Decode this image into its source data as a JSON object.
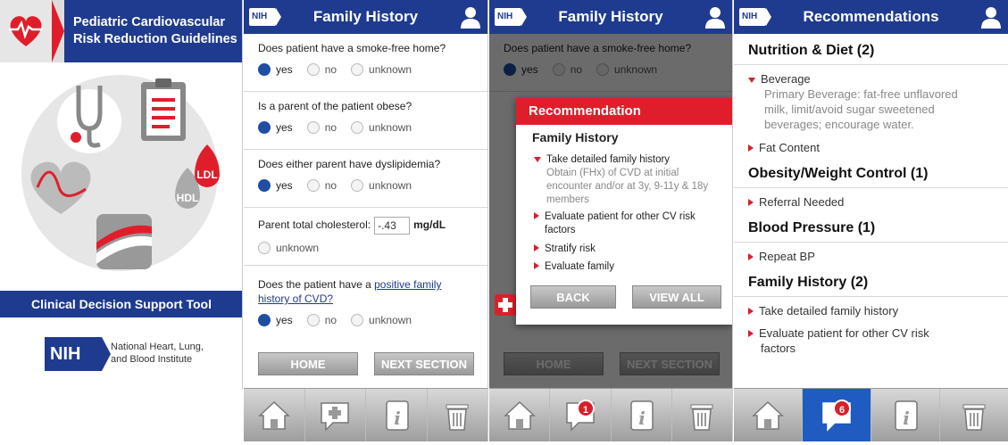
{
  "splash": {
    "title_line1": "Pediatric Cardiovascular",
    "title_line2": "Risk Reduction Guidelines",
    "hdl": "HDL",
    "ldl": "LDL",
    "tool_label": "Clinical Decision Support Tool",
    "nih_logo": "NIH",
    "institute_line1": "National Heart, Lung,",
    "institute_line2": "and Blood Institute"
  },
  "header": {
    "nih_badge": "NIH",
    "family_history_title": "Family History",
    "recommendations_title": "Recommendations"
  },
  "form": {
    "q1": "Does patient have a smoke-free home?",
    "q2": "Is a parent of the patient obese?",
    "q3": "Does either parent have dyslipidemia?",
    "q4_label": "Parent total cholesterol:",
    "q4_value": "-.43",
    "q4_unit": "mg/dL",
    "q5_prefix": "Does the patient have a",
    "q5_link_line1": "positive family",
    "q5_link_line2": "history of CVD?",
    "opt_yes": "yes",
    "opt_no": "no",
    "opt_unknown": "unknown",
    "home_button": "HOME",
    "next_button": "NEXT SECTION"
  },
  "modal": {
    "title": "Recommendation",
    "subtitle": "Family History",
    "item1": "Take detailed family history",
    "item1_detail_l1": "Obtain (FHx) of CVD at initial",
    "item1_detail_l2": "encounter and/or at 3y, 9-11y & 18y",
    "item1_detail_l3": "members",
    "item2_l1": "Evaluate patient for other CV risk",
    "item2_l2": "factors",
    "item3": "Stratify risk",
    "item4": "Evaluate family",
    "back_button": "BACK",
    "view_all_button": "VIEW ALL"
  },
  "tabbar": {
    "badge_panel3": "1",
    "badge_panel4": "6"
  },
  "recs": {
    "nutrition": "Nutrition & Diet (2)",
    "beverage": "Beverage",
    "beverage_d1": "Primary Beverage: fat-free unflavored",
    "beverage_d2": "milk, limit/avoid sugar sweetened",
    "beverage_d3": "beverages; encourage water.",
    "fat": "Fat Content",
    "obesity": "Obesity/Weight Control (1)",
    "referral": "Referral Needed",
    "bp": "Blood Pressure (1)",
    "repeat_bp": "Repeat BP",
    "family": "Family History (2)",
    "fam1": "Take detailed family history",
    "fam2_l1": "Evaluate patient for other CV risk",
    "fam2_l2": "factors"
  },
  "colors": {
    "brand_blue": "#1f3b8f",
    "accent_red": "#e01e2b",
    "tab_active": "#1f5bc0"
  }
}
